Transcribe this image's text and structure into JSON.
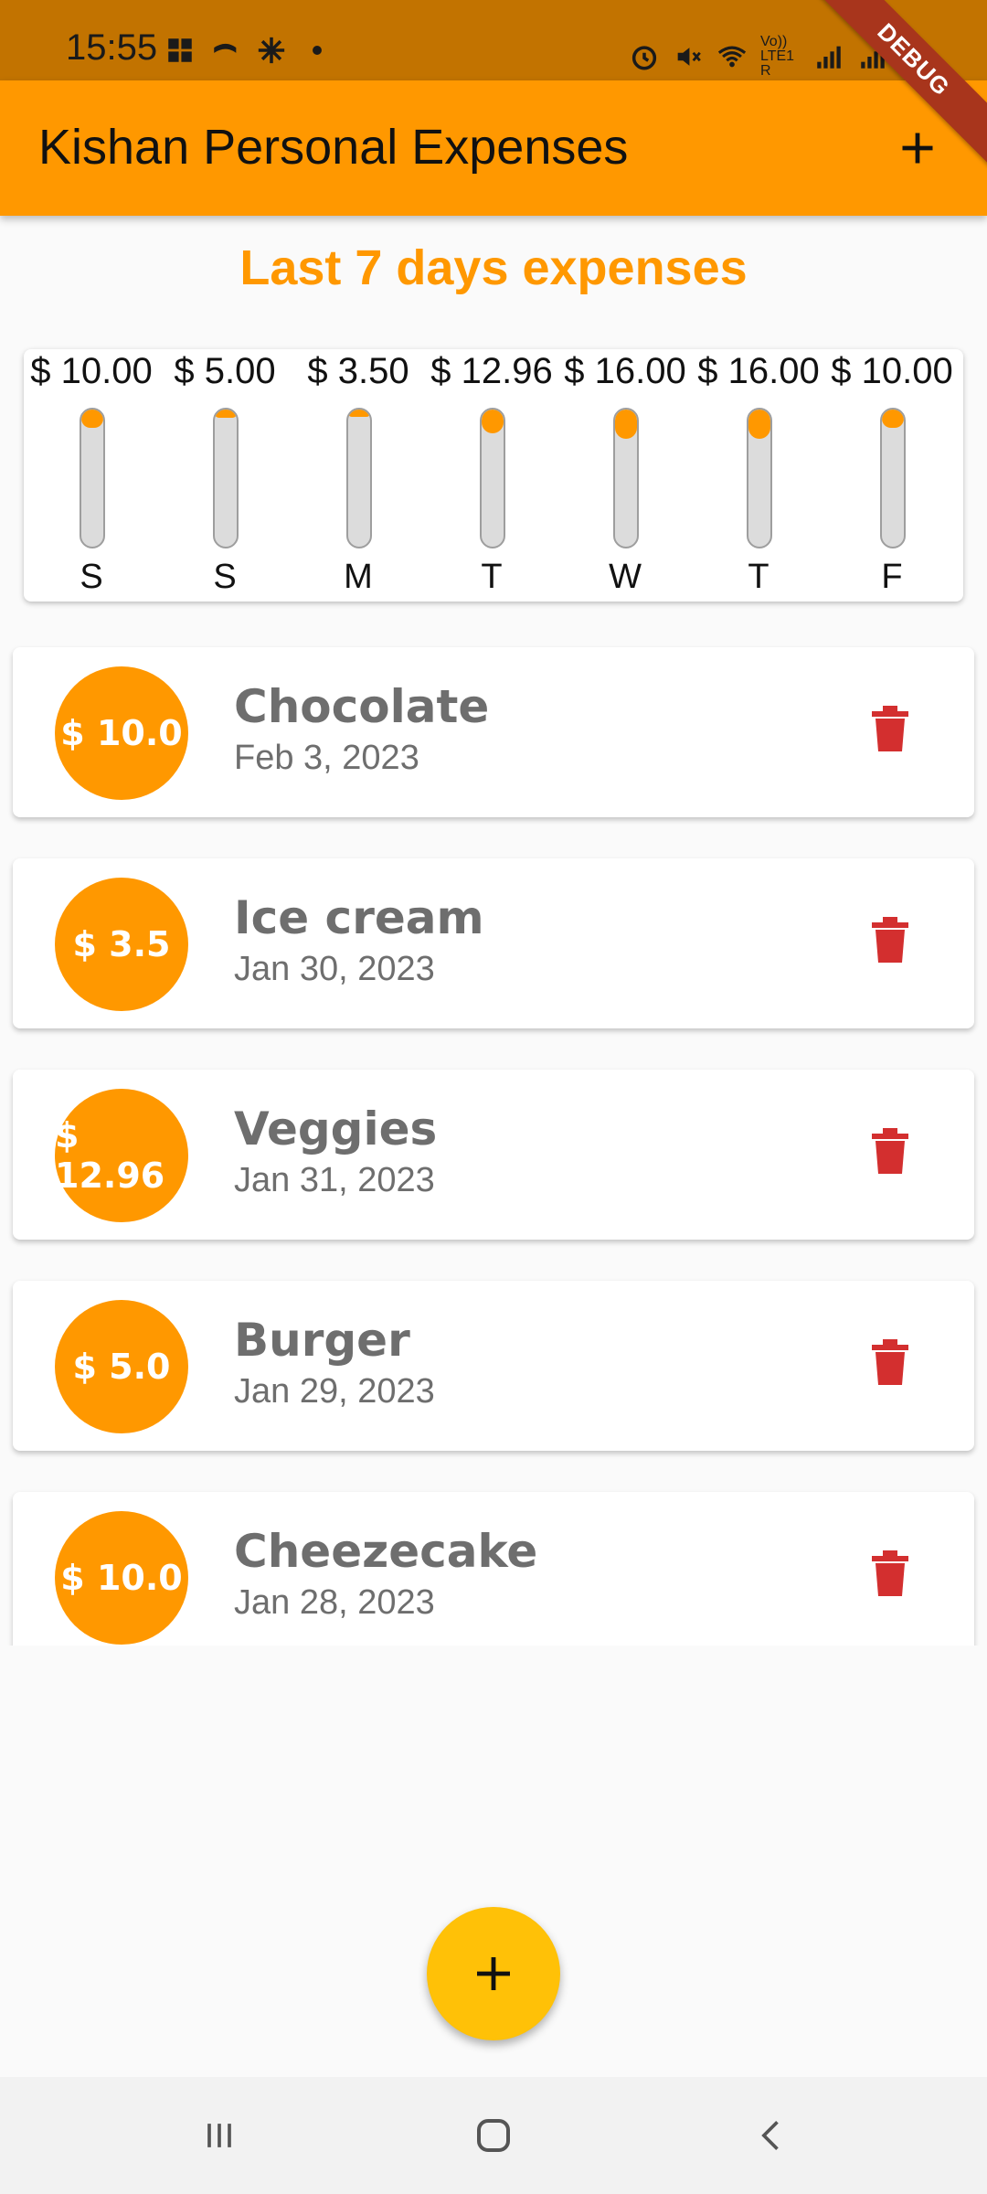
{
  "status_bar": {
    "time": "15:55",
    "left_icons": [
      "notification-icon",
      "cast-icon",
      "sparkle-icon",
      "dot-icon"
    ],
    "right_icons": [
      "alarm-icon",
      "mute-icon",
      "wifi-icon",
      "volte-icon",
      "signal-icon",
      "signal-icon",
      "battery-icon"
    ],
    "volte_label": "Vo)) LTE1 R"
  },
  "debug_banner": "DEBUG",
  "app_bar": {
    "title": "Kishan Personal Expenses",
    "add_icon": "plus-icon"
  },
  "chart_section": {
    "title": "Last 7 days expenses"
  },
  "chart_data": {
    "type": "bar",
    "categories": [
      "S",
      "S",
      "M",
      "T",
      "W",
      "T",
      "F"
    ],
    "values": [
      10.0,
      5.0,
      3.5,
      12.96,
      16.0,
      16.0,
      10.0
    ],
    "labels": [
      "$ 10.00",
      "$ 5.00",
      "$ 3.50",
      "$ 12.96",
      "$ 16.00",
      "$ 16.00",
      "$ 10.00"
    ],
    "fill_fraction": [
      0.13,
      0.06,
      0.05,
      0.17,
      0.21,
      0.21,
      0.13
    ],
    "colors": {
      "fill": "#ff9800",
      "track": "#dcdcdc",
      "border": "#9e9e9e"
    }
  },
  "transactions": [
    {
      "amount": "$ 10.0",
      "title": "Chocolate",
      "date": "Feb 3, 2023"
    },
    {
      "amount": "$ 3.5",
      "title": "Ice cream",
      "date": "Jan 30, 2023"
    },
    {
      "amount": "$ 12.96",
      "title": "Veggies",
      "date": "Jan 31, 2023"
    },
    {
      "amount": "$ 5.0",
      "title": "Burger",
      "date": "Jan 29, 2023"
    },
    {
      "amount": "$ 10.0",
      "title": "Cheezecake",
      "date": "Jan 28, 2023"
    }
  ],
  "colors": {
    "primary": "#ff9800",
    "accent": "#ffc107",
    "delete": "#d32f2f",
    "status_bar": "#c27300"
  },
  "fab": {
    "icon": "plus-icon"
  },
  "nav_bar": {
    "icons": [
      "recents-icon",
      "home-icon",
      "back-icon"
    ]
  }
}
